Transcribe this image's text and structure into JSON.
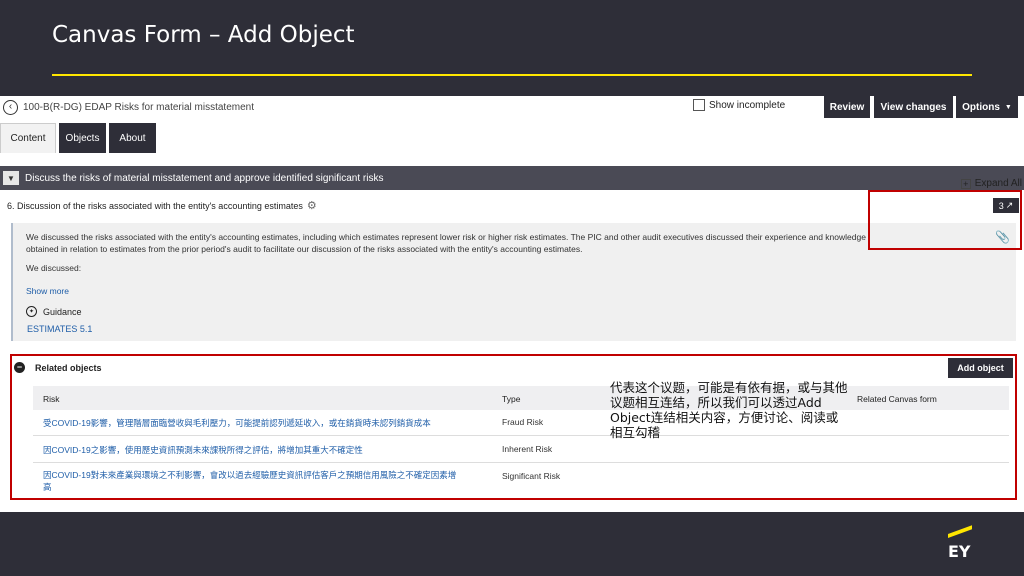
{
  "slide": {
    "title": "Canvas Form – Add Object"
  },
  "topbar": {
    "doc_title": "100-B(R-DG) EDAP Risks for material misstatement",
    "show_incomplete": "Show incomplete",
    "review": "Review",
    "view_changes": "View changes",
    "options": "Options"
  },
  "tabs": [
    {
      "label": "Content"
    },
    {
      "label": "Objects"
    },
    {
      "label": "About"
    }
  ],
  "section": {
    "title": "Discuss the risks of material misstatement and approve identified significant risks",
    "expand_all": "Expand All"
  },
  "question": {
    "title": "6. Discussion of the risks associated with the entity's accounting estimates",
    "text": "We discussed the risks associated with the entity's accounting estimates, including which estimates represent lower risk or higher risk estimates. The PIC and other audit executives discussed their experience and knowledge obtained in relation to estimates from the prior period's audit to facilitate our discussion of the risks associated with the entity's accounting estimates.",
    "we_discussed": "We discussed:",
    "show_more": "Show more",
    "guidance": "Guidance",
    "estimates_link": "ESTIMATES 5.1",
    "badge_count": "3"
  },
  "related_objects": {
    "title": "Related objects",
    "add_button": "Add object",
    "columns": [
      "Risk",
      "Type",
      "Related Canvas form"
    ],
    "rows": [
      {
        "risk": "受COVID-19影響，管理階層面臨營收與毛利壓力，可能提前認列遞延收入，或在銷貨時未認列銷貨成本",
        "type": "Fraud Risk"
      },
      {
        "risk": "因COVID-19之影響，使用歷史資訊預測未來課稅所得之評估，將增加其重大不確定性",
        "type": "Inherent Risk"
      },
      {
        "risk": "因COVID-19對未來產業與環境之不利影響，會改以過去經驗歷史資訊評估客戶之預期信用風險之不確定因素增高",
        "type": "Significant Risk"
      }
    ]
  },
  "annotation": "代表这个议题，可能是有依有据，或与其他议题相互连结，所以我们可以透过Add Object连结相关内容，方便讨论、阅读或相互勾稽",
  "logo": {
    "text": "EY"
  },
  "colors": {
    "accent": "#ffe600",
    "dark": "#2e2e38",
    "highlight": "#c00000",
    "link": "#1f5ea8"
  }
}
